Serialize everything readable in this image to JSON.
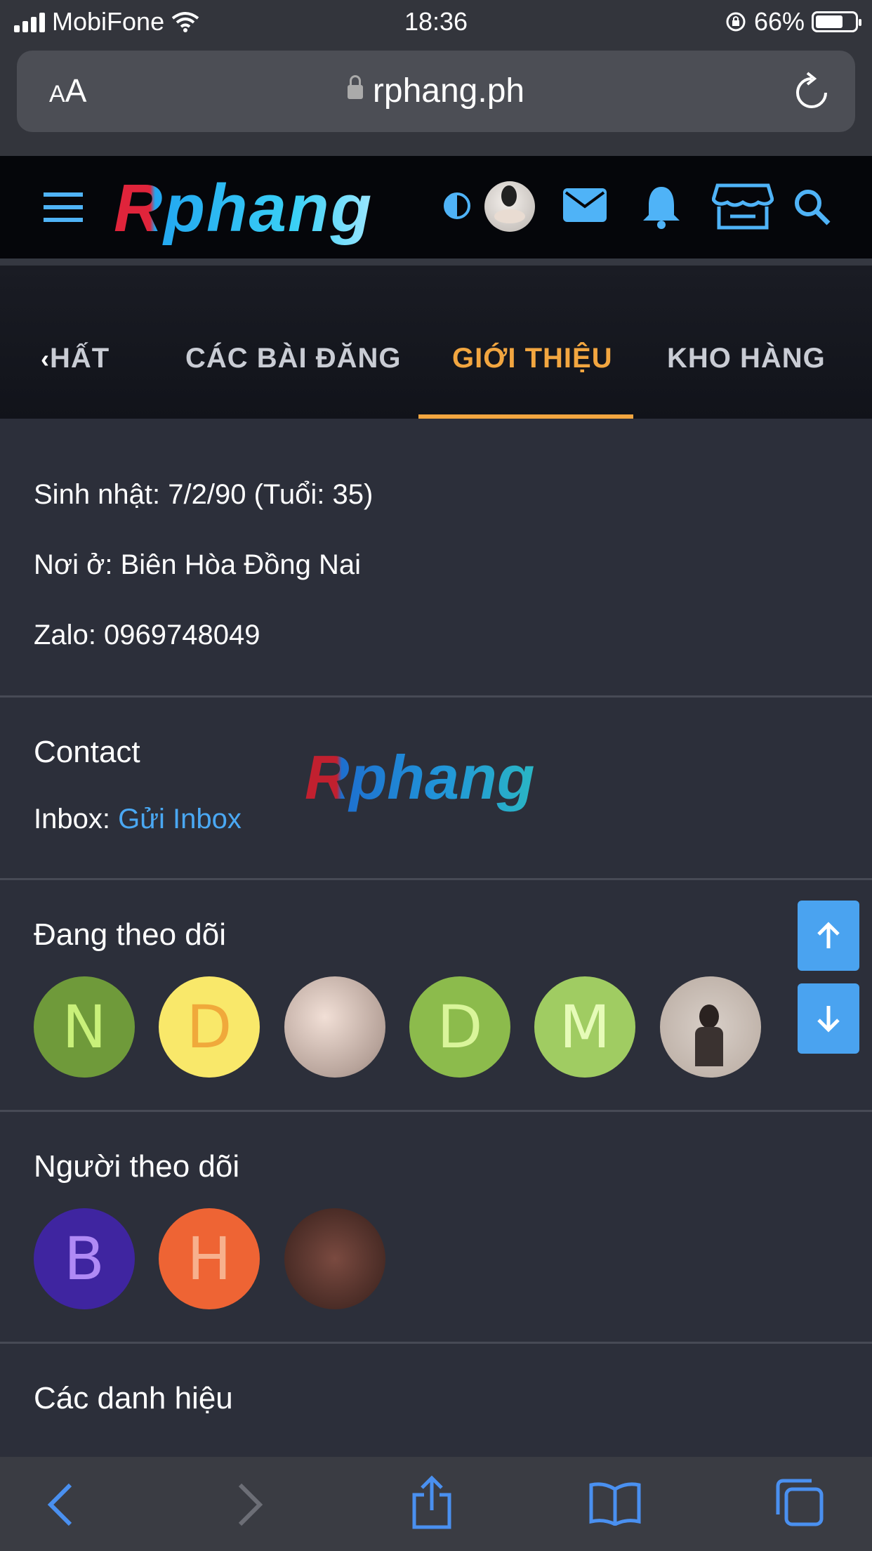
{
  "status": {
    "carrier": "MobiFone",
    "time": "18:36",
    "battery": "66%"
  },
  "browser": {
    "text_size_small": "A",
    "text_size_large": "A",
    "domain": "rphang.ph"
  },
  "site": {
    "logo": "Rphang"
  },
  "tabs": [
    {
      "label": "HẤT"
    },
    {
      "label": "CÁC BÀI ĐĂNG"
    },
    {
      "label": "GIỚI THIỆU",
      "active": true
    },
    {
      "label": "KHO HÀNG"
    }
  ],
  "about": {
    "birthday": "Sinh nhật: 7/2/90 (Tuổi: 35)",
    "location": "Nơi ở: Biên Hòa Đồng Nai",
    "zalo": "Zalo: 0969748049"
  },
  "contact": {
    "title": "Contact",
    "inbox_label": "Inbox: ",
    "inbox_link": "Gửi Inbox",
    "watermark": "Rphang"
  },
  "following": {
    "title": "Đang theo dõi",
    "users": [
      {
        "letter": "N",
        "bg": "#6f9a3a",
        "fg": "#c9f07a"
      },
      {
        "letter": "D",
        "bg": "#f9e86a",
        "fg": "#f0a93b"
      },
      {
        "letter": "",
        "kind": "photo"
      },
      {
        "letter": "D",
        "bg": "#8cbb4c",
        "fg": "#d9f59a"
      },
      {
        "letter": "M",
        "bg": "#a0cc62",
        "fg": "#e6fbb8"
      },
      {
        "letter": "",
        "kind": "photo"
      }
    ]
  },
  "followers": {
    "title": "Người theo dõi",
    "users": [
      {
        "letter": "B",
        "bg": "#3f25a0",
        "fg": "#b08af5"
      },
      {
        "letter": "H",
        "bg": "#ee6434",
        "fg": "#f7b08d"
      },
      {
        "letter": "",
        "kind": "photo"
      }
    ]
  },
  "titles": {
    "title": "Các danh hiệu"
  },
  "colors": {
    "accent": "#f2a640",
    "link": "#4aa8f3",
    "icon_blue": "#4fb3f7",
    "background": "#2c2f3a"
  }
}
